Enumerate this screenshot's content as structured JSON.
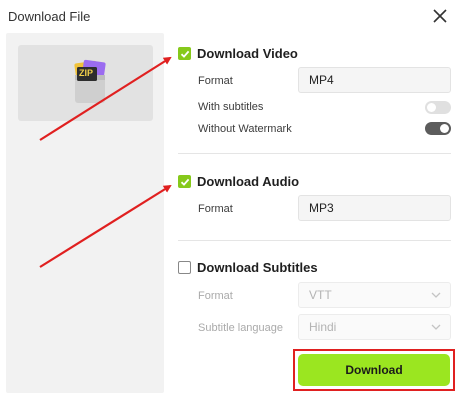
{
  "dialog": {
    "title": "Download File"
  },
  "icons": {
    "close": "close-icon",
    "file": "zip-file-icon",
    "check": "checkmark-icon",
    "chevron": "chevron-down-icon"
  },
  "colors": {
    "accent": "#9be620",
    "checkbox": "#86c91b",
    "annotation": "#e02020"
  },
  "preview": {
    "file_badge": "ZIP"
  },
  "video": {
    "label": "Download Video",
    "checked": true,
    "format_label": "Format",
    "format_value": "MP4",
    "subtitles_label": "With subtitles",
    "subtitles_on": false,
    "watermark_label": "Without Watermark",
    "watermark_on": true
  },
  "audio": {
    "label": "Download Audio",
    "checked": true,
    "format_label": "Format",
    "format_value": "MP3"
  },
  "subtitles": {
    "label": "Download Subtitles",
    "checked": false,
    "format_label": "Format",
    "format_value": "VTT",
    "language_label": "Subtitle language",
    "language_value": "Hindi"
  },
  "actions": {
    "download_label": "Download"
  }
}
